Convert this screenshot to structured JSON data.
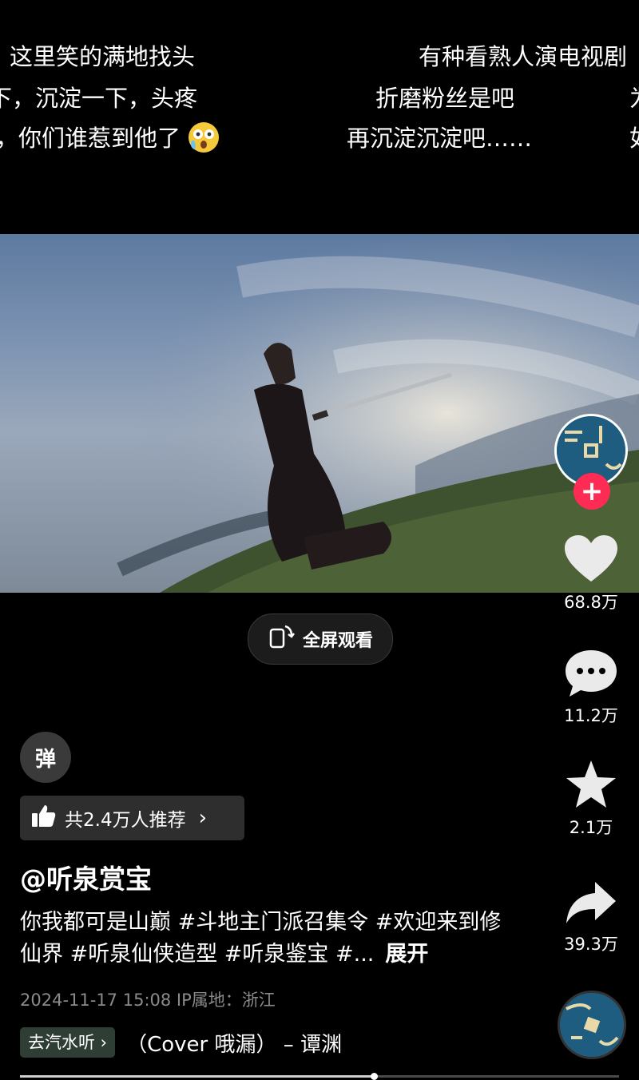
{
  "danmaku": [
    {
      "text": "这里笑的满地找头"
    },
    {
      "text": "有种看熟人演电视剧"
    },
    {
      "text": "下，沉淀一下，头疼"
    },
    {
      "text": "折磨粉丝是吧"
    },
    {
      "text": "为"
    },
    {
      "text": "，你们谁惹到他了"
    },
    {
      "text": "再沉淀沉淀吧……"
    },
    {
      "text": "如"
    }
  ],
  "fullscreen": {
    "label": "全屏观看",
    "icon": "rotate-screen-icon"
  },
  "actions": {
    "like_count": "68.8万",
    "comment_count": "11.2万",
    "favorite_count": "2.1万",
    "share_count": "39.3万"
  },
  "danmu_toggle": "弹",
  "recommend": "共2.4万人推荐",
  "author": "@听泉赏宝",
  "description": {
    "text": "你我都可是山巅 #斗地主门派召集令 #欢迎来到修仙界 #听泉仙侠造型 #听泉鉴宝 #...",
    "expand": "展开"
  },
  "meta": "2024-11-17 15:08  IP属地：浙江",
  "music": {
    "tag": "去汽水听",
    "title": "（Cover 哦漏） – 谭渊"
  },
  "progress": 0.59,
  "colors": {
    "follow": "#fe2c55",
    "background": "#000000"
  }
}
